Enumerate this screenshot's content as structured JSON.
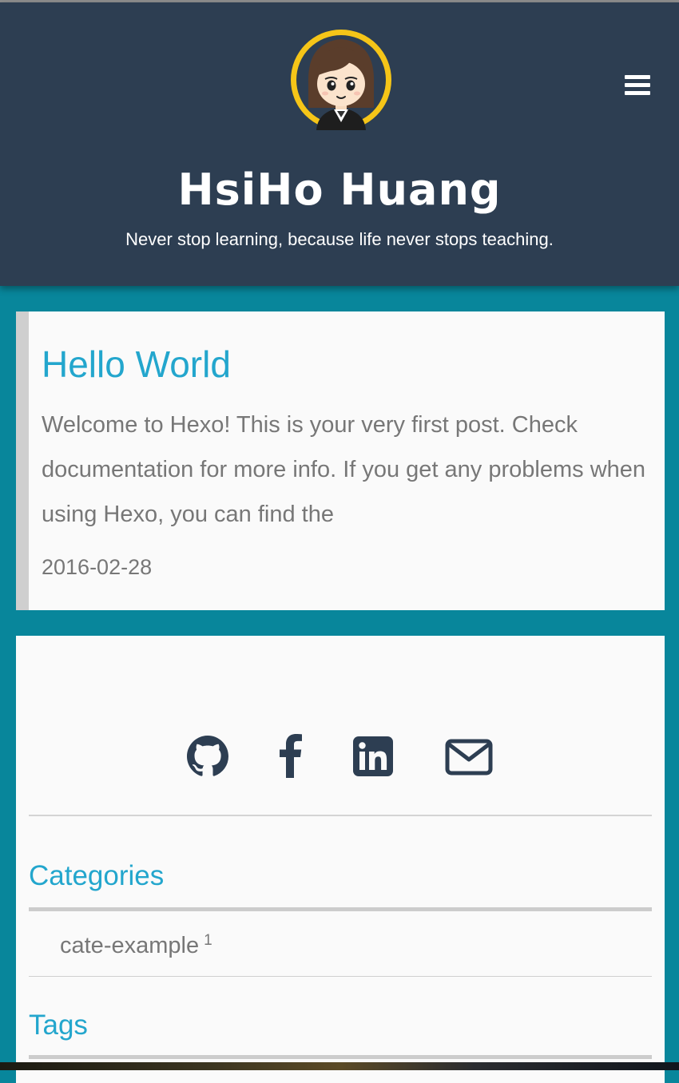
{
  "header": {
    "title": "HsiHo Huang",
    "subtitle": "Never stop learning, because life never stops teaching."
  },
  "post": {
    "title": "Hello World",
    "excerpt": "Welcome to Hexo! This is your very first post. Check documentation for more info. If you get any problems when using Hexo, you can find the",
    "date": "2016-02-28"
  },
  "sidebar": {
    "social": [
      {
        "icon": "github-icon"
      },
      {
        "icon": "facebook-icon"
      },
      {
        "icon": "linkedin-icon"
      },
      {
        "icon": "mail-icon"
      }
    ],
    "categories_heading": "Categories",
    "categories": [
      {
        "name": "cate-example",
        "count": "1"
      }
    ],
    "tags_heading": "Tags"
  },
  "colors": {
    "header_bg": "#2d3e52",
    "page_bg": "#08869b",
    "accent": "#23a6cd",
    "text_muted": "#777777",
    "icon": "#2d3e52"
  }
}
